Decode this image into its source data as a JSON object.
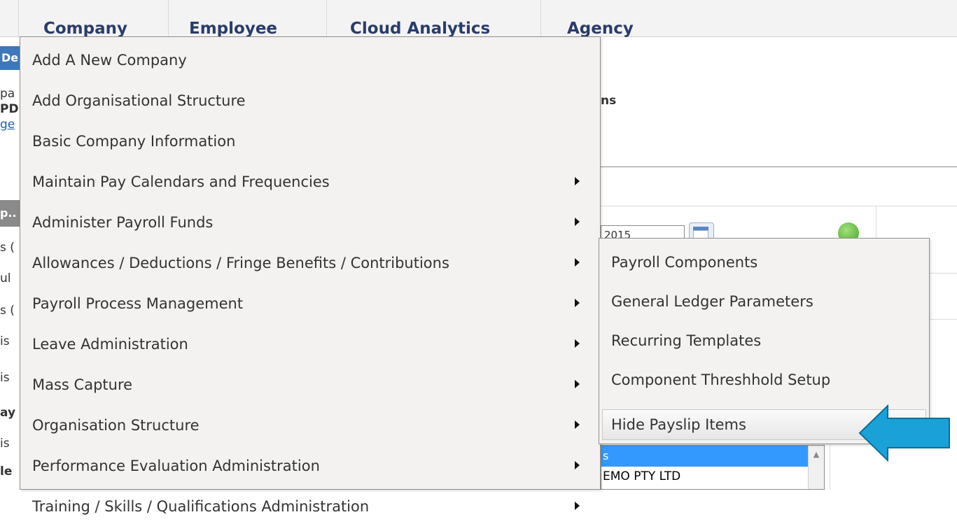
{
  "nav": {
    "tabs": [
      {
        "label": "Company"
      },
      {
        "label": "Employee"
      },
      {
        "label": "Cloud Analytics"
      },
      {
        "label": "Agency"
      }
    ]
  },
  "background": {
    "left_fragments": [
      "De",
      "pa",
      "PD",
      "ge",
      "p..",
      "s (",
      "ul",
      "s (",
      "is",
      "is",
      "ay",
      "is",
      "le"
    ],
    "right_heading_fragment": "ns",
    "date_value": "2015",
    "listbox_selected": "s",
    "listbox_item": "EMO PTY LTD"
  },
  "menu": {
    "items": [
      {
        "label": "Add A New Company",
        "has_submenu": false
      },
      {
        "label": "Add Organisational Structure",
        "has_submenu": false
      },
      {
        "label": "Basic Company Information",
        "has_submenu": false
      },
      {
        "label": "Maintain Pay Calendars and Frequencies",
        "has_submenu": true
      },
      {
        "label": "Administer Payroll Funds",
        "has_submenu": true
      },
      {
        "label": "Allowances / Deductions / Fringe Benefits / Contributions",
        "has_submenu": true
      },
      {
        "label": "Payroll Process Management",
        "has_submenu": true
      },
      {
        "label": "Leave Administration",
        "has_submenu": true
      },
      {
        "label": "Mass Capture",
        "has_submenu": true
      },
      {
        "label": "Organisation Structure",
        "has_submenu": true
      },
      {
        "label": "Performance Evaluation Administration",
        "has_submenu": true
      },
      {
        "label": "Training / Skills / Qualifications Administration",
        "has_submenu": true
      }
    ]
  },
  "submenu": {
    "items": [
      {
        "label": "Payroll Components"
      },
      {
        "label": "General Ledger Parameters"
      },
      {
        "label": "Recurring Templates"
      },
      {
        "label": "Component Threshhold Setup"
      },
      {
        "label": "Hide Payslip Items",
        "highlighted": true
      }
    ]
  },
  "colors": {
    "menu_bg": "#f3f2f1",
    "nav_text": "#2a3c6b",
    "selection_blue": "#3399ff",
    "annotation_arrow": "#1aa1d8"
  }
}
